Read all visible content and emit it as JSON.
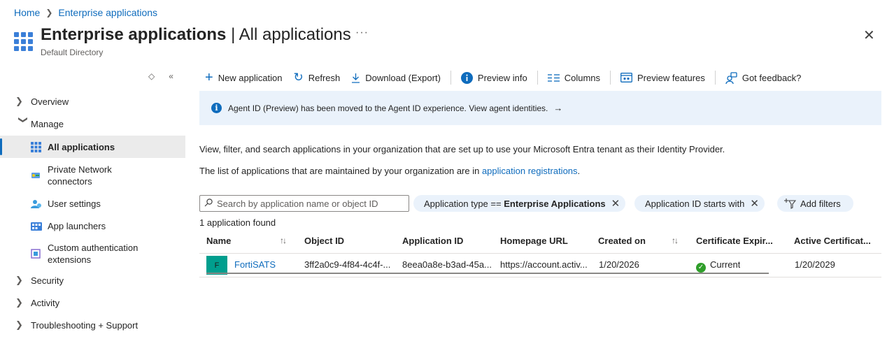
{
  "breadcrumb": {
    "home": "Home",
    "current": "Enterprise applications"
  },
  "header": {
    "title": "Enterprise applications",
    "separator": " | ",
    "subtitle_part": "All applications",
    "directory": "Default Directory",
    "more": "···",
    "close": "✕"
  },
  "nav": {
    "tools": {
      "expand": "◇",
      "collapse": "«"
    },
    "items": {
      "overview": "Overview",
      "manage": "Manage",
      "all_applications": "All applications",
      "private_network_line1": "Private Network",
      "private_network_line2": "connectors",
      "user_settings": "User settings",
      "app_launchers": "App launchers",
      "custom_auth_line1": "Custom authentication",
      "custom_auth_line2": "extensions",
      "security": "Security",
      "activity": "Activity",
      "troubleshooting": "Troubleshooting + Support"
    }
  },
  "toolbar": {
    "new_application": "New application",
    "refresh": "Refresh",
    "download": "Download (Export)",
    "preview_info": "Preview info",
    "columns": "Columns",
    "preview_features": "Preview features",
    "feedback": "Got feedback?"
  },
  "banner": {
    "text": "Agent ID (Preview) has been moved to the Agent ID experience. View agent identities.",
    "arrow": "→"
  },
  "description": {
    "line1": "View, filter, and search applications in your organization that are set up to use your Microsoft Entra tenant as their Identity Provider.",
    "line2_prefix": "The list of applications that are maintained by your organization are in ",
    "line2_link": "application registrations",
    "line2_suffix": "."
  },
  "filters": {
    "search_placeholder": "Search by application name or object ID",
    "pill1_prefix": "Application type == ",
    "pill1_value": "Enterprise Applications",
    "pill2": "Application ID starts with",
    "add_filters": "Add filters"
  },
  "result_count": "1 application found",
  "table": {
    "headers": {
      "name": "Name",
      "object_id": "Object ID",
      "application_id": "Application ID",
      "homepage_url": "Homepage URL",
      "created_on": "Created on",
      "cert_expiry": "Certificate Expir...",
      "active_cert": "Active Certificat..."
    },
    "rows": [
      {
        "badge": "F",
        "name": "FortiSATS",
        "object_id": "3ff2a0c9-4f84-4c4f-...",
        "application_id": "8eea0a8e-b3ad-45a...",
        "homepage_url": "https://account.activ...",
        "created_on": "1/20/2026",
        "cert_status": "Current",
        "active_cert": "1/20/2029"
      }
    ]
  },
  "colors": {
    "accent": "#0f6cbd",
    "banner_bg": "#eaf2fb",
    "badge_bg": "#009e8e",
    "status_ok": "#2f9e2a"
  }
}
